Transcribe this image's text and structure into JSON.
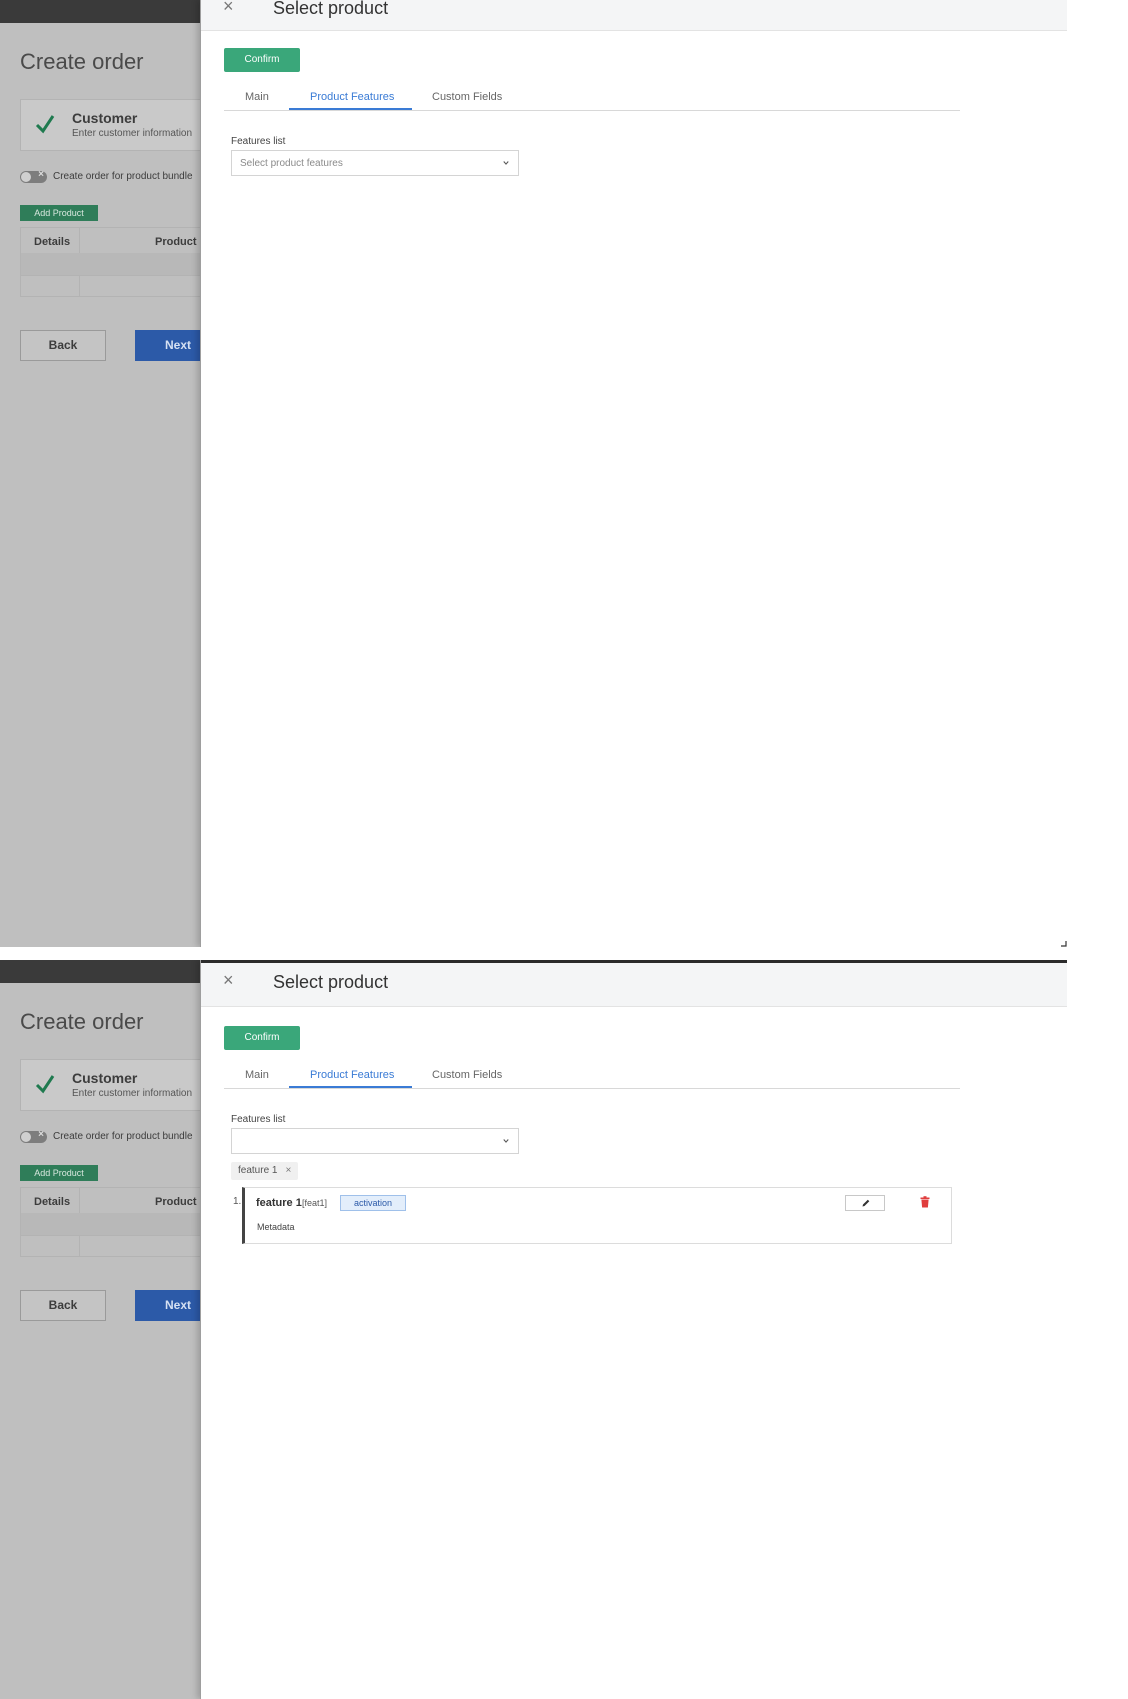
{
  "background": {
    "title": "Create order",
    "step": {
      "title": "Customer",
      "subtitle": "Enter customer information"
    },
    "bundle_toggle_label": "Create order for product bundle",
    "add_product_label": "Add Product",
    "table_headers": [
      "Details",
      "Product"
    ],
    "back_label": "Back",
    "next_label": "Next"
  },
  "drawer": {
    "close_symbol": "×",
    "title": "Select product",
    "confirm_label": "Confirm",
    "tabs": [
      {
        "label": "Main",
        "active": false
      },
      {
        "label": "Product Features",
        "active": true
      },
      {
        "label": "Custom Fields",
        "active": false
      }
    ],
    "features_label": "Features list",
    "placeholder": "Select product features"
  },
  "selected": {
    "chip_label": "feature 1",
    "chip_close": "×",
    "feature": {
      "index": "1.",
      "name": "feature 1",
      "code": "[feat1]",
      "tag": "activation",
      "metadata_label": "Metadata"
    }
  },
  "colors": {
    "accent_blue": "#3a7bd5",
    "confirm_green": "#3aa77a",
    "delete_red": "#e03e3e"
  },
  "icons": [
    "close-icon",
    "check-icon",
    "chevron-down-icon",
    "pencil-icon",
    "trash-icon"
  ]
}
